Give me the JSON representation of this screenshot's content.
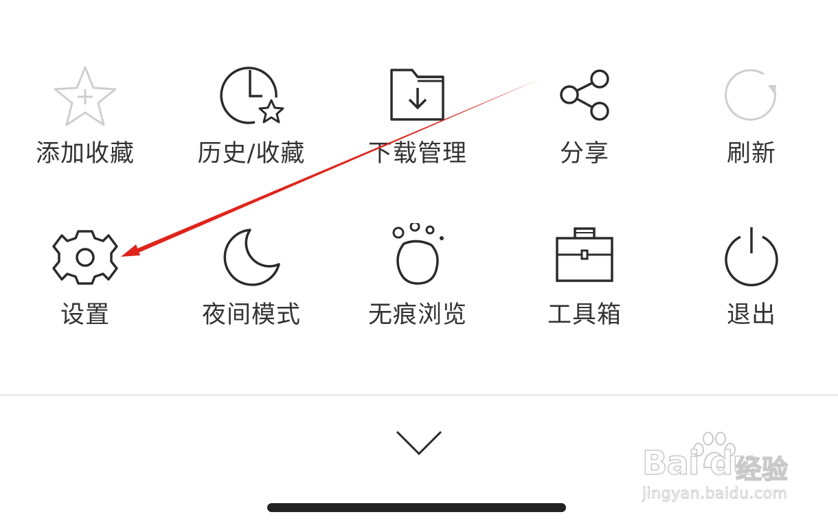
{
  "menu": {
    "row1": [
      {
        "id": "favorite",
        "label": "添加收藏",
        "icon": "star-plus-icon",
        "disabled": true
      },
      {
        "id": "history",
        "label": "历史/收藏",
        "icon": "clock-star-icon",
        "disabled": false
      },
      {
        "id": "downloads",
        "label": "下载管理",
        "icon": "folder-download-icon",
        "disabled": false
      },
      {
        "id": "share",
        "label": "分享",
        "icon": "share-icon",
        "disabled": false
      },
      {
        "id": "refresh",
        "label": "刷新",
        "icon": "refresh-icon",
        "disabled": true
      }
    ],
    "row2": [
      {
        "id": "settings",
        "label": "设置",
        "icon": "gear-icon",
        "disabled": false
      },
      {
        "id": "night",
        "label": "夜间模式",
        "icon": "moon-icon",
        "disabled": false
      },
      {
        "id": "incognito",
        "label": "无痕浏览",
        "icon": "paw-icon",
        "disabled": false
      },
      {
        "id": "toolbox",
        "label": "工具箱",
        "icon": "toolbox-icon",
        "disabled": false
      },
      {
        "id": "exit",
        "label": "退出",
        "icon": "power-icon",
        "disabled": false
      }
    ]
  },
  "collapse_icon": "chevron-down-icon",
  "watermark": {
    "brand": "Bai du",
    "cn": "经验",
    "url": "jingyan.baidu.com"
  },
  "colors": {
    "icon_active": "#2b2b2b",
    "icon_disabled": "#c8c8c8",
    "annotation": "#e2231a"
  }
}
